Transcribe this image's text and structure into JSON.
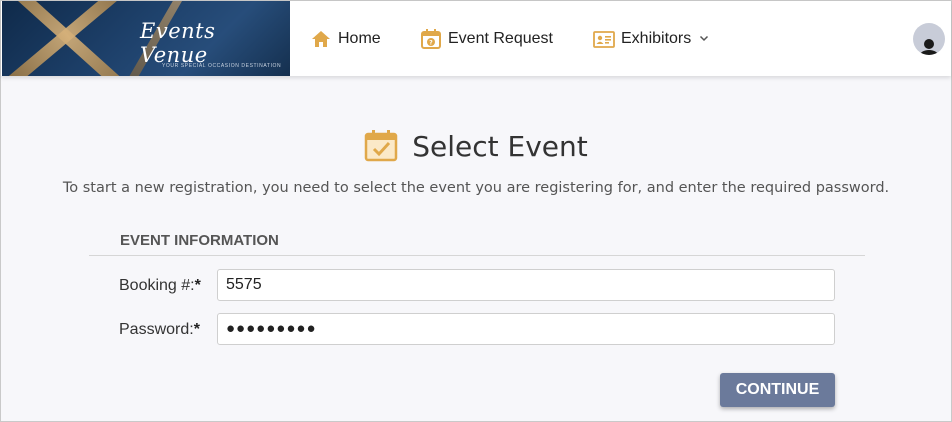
{
  "header": {
    "logo": {
      "title": "Events Venue",
      "tagline": "YOUR SPECIAL OCCASION DESTINATION"
    },
    "nav": [
      {
        "label": "Home",
        "icon": "home-icon"
      },
      {
        "label": "Event Request",
        "icon": "calendar-question-icon"
      },
      {
        "label": "Exhibitors",
        "icon": "id-card-icon",
        "has_dropdown": true
      }
    ],
    "accent_color": "#e0a84a"
  },
  "main": {
    "title": "Select Event",
    "title_icon": "calendar-check-icon",
    "instructions": "To start a new registration, you need to select the event you are registering for, and enter the required password.",
    "section_title": "EVENT INFORMATION",
    "fields": {
      "booking": {
        "label": "Booking #:",
        "required_mark": "*",
        "value": "5575"
      },
      "password": {
        "label": "Password:",
        "required_mark": "*",
        "value": "●●●●●●●●●"
      }
    },
    "continue_label": "CONTINUE",
    "button_color": "#6b7a9b"
  }
}
